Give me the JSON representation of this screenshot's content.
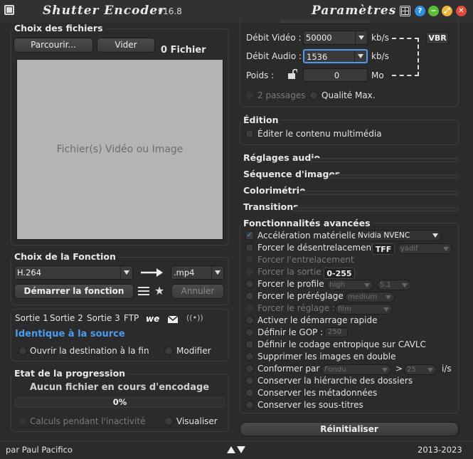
{
  "window": {
    "title": "Shutter Encoder",
    "version": "v16.8",
    "settings_title": "Paramètres"
  },
  "files": {
    "section_title": "Choix des fichiers",
    "browse_label": "Parcourir...",
    "clear_label": "Vider",
    "count_label": "0 Fichier",
    "drop_placeholder": "Fichier(s) Vidéo ou Image"
  },
  "function": {
    "section_title": "Choix de la Fonction",
    "codec": "H.264",
    "container": ".mp4",
    "start_label": "Démarrer la fonction",
    "cancel_label": "Annuler"
  },
  "output": {
    "tabs": [
      "Sortie 1",
      "Sortie 2",
      "Sortie 3",
      "FTP"
    ],
    "destination": "Identique à la source",
    "open_dest_label": "Ouvrir la destination à la fin",
    "modify_label": "Modifier"
  },
  "progress": {
    "section_title": "Etat de la progression",
    "status": "Aucun fichier en cours d'encodage",
    "percent": "0%",
    "percent_value": 0,
    "idle_calc_label": "Calculs pendant l'inactivité",
    "preview_label": "Visualiser"
  },
  "bitrate": {
    "video_label": "Débit Vidéo :",
    "video_value": "50000",
    "video_unit": "kb/s",
    "vbr_label": "VBR",
    "audio_label": "Débit Audio :",
    "audio_value": "1536",
    "audio_unit": "kb/s",
    "size_label": "Poids :",
    "size_value": "0",
    "size_unit": "Mo",
    "two_pass_label": "2 passages",
    "max_quality_label": "Qualité Max."
  },
  "edition": {
    "section_title": "Édition",
    "edit_media_label": "Éditer le contenu multimédia"
  },
  "collapsed_sections": [
    "Réglages audio",
    "Séquence d'images",
    "Colorimétrie",
    "Transitions"
  ],
  "advanced": {
    "section_title": "Fonctionnalités avancées",
    "hw_accel_label": "Accélération matérielle :",
    "hw_accel_value": "Nvidia NVENC",
    "deinterlace_label": "Forcer le désentrelacement :",
    "deinterlace_tag": "TFF",
    "deinterlace_value": "yadif",
    "interlace_label": "Forcer l'entrelacement",
    "output_label": "Forcer la sortie :",
    "output_tag": "0-255",
    "profile_label": "Forcer le profile :",
    "profile_value": "high",
    "level_value": "5.1",
    "preset_label": "Forcer le préréglage :",
    "preset_value": "medium",
    "tune_label": "Forcer le réglage :",
    "tune_value": "film",
    "fast_start_label": "Activer le démarrage rapide",
    "gop_label": "Définir le GOP :",
    "gop_value": "250",
    "cavlc_label": "Définir le codage entropique sur CAVLC",
    "remove_dup_label": "Supprimer les images en double",
    "conform_label": "Conformer par :",
    "conform_value": "Fondu",
    "conform_symbol": ">",
    "fps_value": "25",
    "fps_unit": "i/s",
    "keep_folders_label": "Conserver la hiérarchie des dossiers",
    "keep_metadata_label": "Conserver les métadonnées",
    "keep_subs_label": "Conserver les sous-titres"
  },
  "reset_label": "Réinitialiser",
  "footer": {
    "author": "par Paul Pacifico",
    "years": "2013-2023"
  },
  "colors": {
    "background": "#2b2b2b",
    "accent_blue": "#4a9cf0",
    "title_text": "#e8e8e8"
  },
  "icons": {
    "window_controls": [
      "window-icon",
      "help-icon",
      "minimize-icon",
      "maximize-icon",
      "close-icon"
    ],
    "output_tabs": [
      "wetransfer-icon",
      "mail-icon",
      "stream-icon"
    ],
    "function": [
      "arrow-right-icon",
      "list-icon",
      "star-icon"
    ],
    "size_lock": "unlock-icon",
    "footer": "expand-collapse-icon"
  }
}
